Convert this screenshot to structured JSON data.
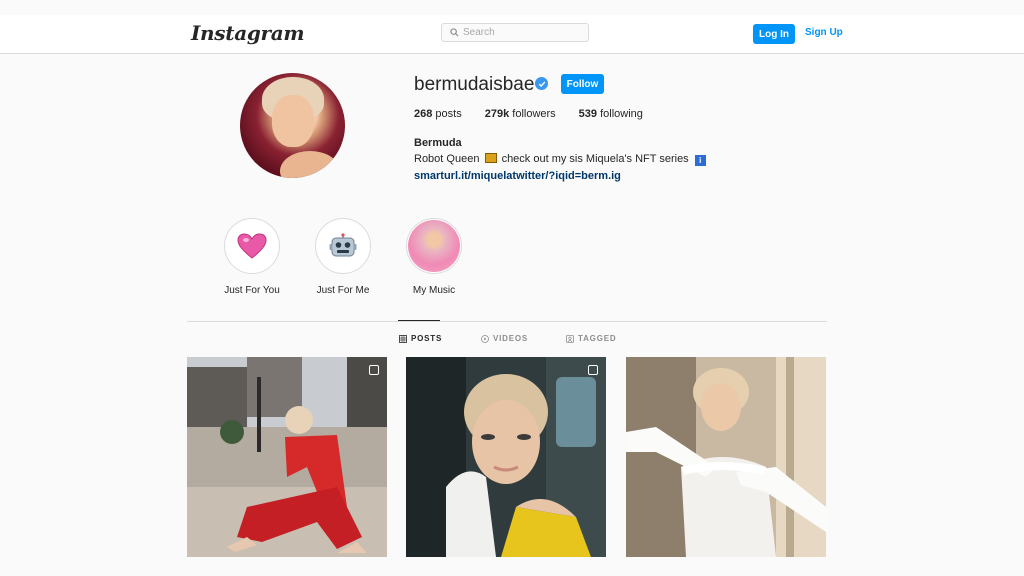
{
  "header": {
    "logo_text": "Instagram",
    "search_placeholder": "Search",
    "login_label": "Log In",
    "signup_label": "Sign Up"
  },
  "profile": {
    "username": "bermudaisbae",
    "verified": true,
    "follow_label": "Follow",
    "stats": {
      "posts_count": "268",
      "posts_label": "posts",
      "followers_count": "279k",
      "followers_label": "followers",
      "following_count": "539",
      "following_label": "following"
    },
    "full_name": "Bermuda",
    "bio_part1": "Robot Queen",
    "bio_part2": "check out my sis Miquela's NFT series",
    "link": "smarturl.it/miquelatwitter/?iqid=berm.ig"
  },
  "highlights": [
    {
      "label": "Just For You",
      "icon": "pink-heart-icon"
    },
    {
      "label": "Just For Me",
      "icon": "robot-face-icon"
    },
    {
      "label": "My Music",
      "icon": "photo-thumbnail"
    }
  ],
  "tabs": [
    {
      "label": "POSTS",
      "icon": "grid-icon",
      "active": true
    },
    {
      "label": "VIDEOS",
      "icon": "play-circle-icon",
      "active": false
    },
    {
      "label": "TAGGED",
      "icon": "tag-icon",
      "active": false
    }
  ],
  "colors": {
    "accent": "#0095f6",
    "link": "#00376b",
    "verified": "#3897f0"
  }
}
